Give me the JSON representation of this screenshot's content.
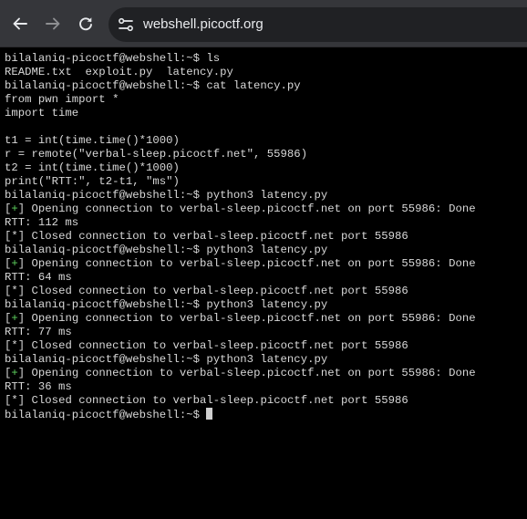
{
  "browser": {
    "url": "webshell.picoctf.org",
    "back_icon": "arrow-left-icon",
    "forward_icon": "arrow-right-icon",
    "reload_icon": "reload-icon",
    "site_info_icon": "tune-icon"
  },
  "terminal": {
    "lines": [
      {
        "text": "bilalaniq-picoctf@webshell:~$ ls"
      },
      {
        "text": "README.txt  exploit.py  latency.py"
      },
      {
        "text": "bilalaniq-picoctf@webshell:~$ cat latency.py"
      },
      {
        "text": "from pwn import *"
      },
      {
        "text": "import time"
      },
      {
        "text": ""
      },
      {
        "text": "t1 = int(time.time()*1000)"
      },
      {
        "text": "r = remote(\"verbal-sleep.picoctf.net\", 55986)"
      },
      {
        "text": "t2 = int(time.time()*1000)"
      },
      {
        "text": "print(\"RTT:\", t2-t1, \"ms\")"
      },
      {
        "text": "bilalaniq-picoctf@webshell:~$ python3 latency.py"
      },
      {
        "text": "Opening connection to verbal-sleep.picoctf.net on port 55986: Done",
        "marker": "+"
      },
      {
        "text": "RTT: 112 ms"
      },
      {
        "text": "Closed connection to verbal-sleep.picoctf.net port 55986",
        "marker": "*"
      },
      {
        "text": "bilalaniq-picoctf@webshell:~$ python3 latency.py"
      },
      {
        "text": "Opening connection to verbal-sleep.picoctf.net on port 55986: Done",
        "marker": "+"
      },
      {
        "text": "RTT: 64 ms"
      },
      {
        "text": "Closed connection to verbal-sleep.picoctf.net port 55986",
        "marker": "*"
      },
      {
        "text": "bilalaniq-picoctf@webshell:~$ python3 latency.py"
      },
      {
        "text": "Opening connection to verbal-sleep.picoctf.net on port 55986: Done",
        "marker": "+"
      },
      {
        "text": "RTT: 77 ms"
      },
      {
        "text": "Closed connection to verbal-sleep.picoctf.net port 55986",
        "marker": "*"
      },
      {
        "text": "bilalaniq-picoctf@webshell:~$ python3 latency.py"
      },
      {
        "text": "Opening connection to verbal-sleep.picoctf.net on port 55986: Done",
        "marker": "+"
      },
      {
        "text": "RTT: 36 ms"
      },
      {
        "text": "Closed connection to verbal-sleep.picoctf.net port 55986",
        "marker": "*"
      },
      {
        "text": "bilalaniq-picoctf@webshell:~$",
        "cursor": true
      }
    ]
  },
  "colors": {
    "toolbar_bg": "#35363a",
    "omnibox_bg": "#202124",
    "terminal_bg": "#000000",
    "terminal_text": "#d8d8d8",
    "success_marker": "#5fd35f"
  }
}
